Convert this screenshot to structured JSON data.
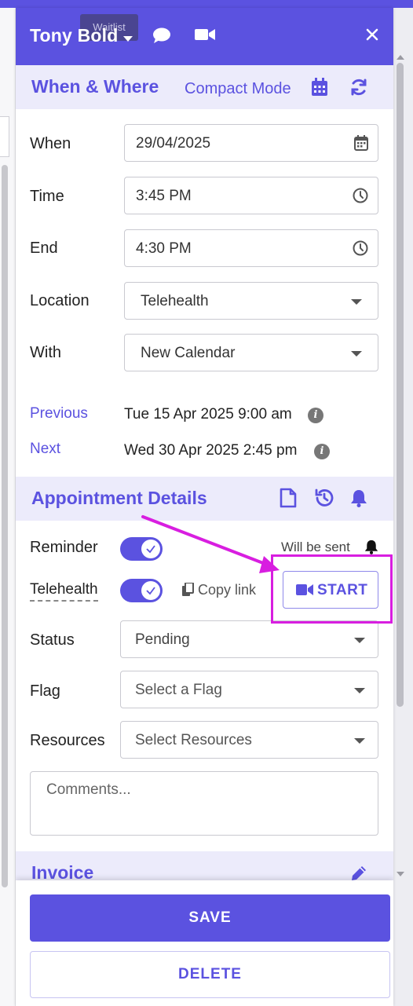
{
  "header": {
    "patient_name": "Tony Bold",
    "tooltip": "Waitlist"
  },
  "when_where": {
    "title": "When & Where",
    "compact_mode": "Compact Mode",
    "when_label": "When",
    "when_value": "29/04/2025",
    "time_label": "Time",
    "time_value": "3:45 PM",
    "end_label": "End",
    "end_value": "4:30 PM",
    "location_label": "Location",
    "location_value": "Telehealth",
    "with_label": "With",
    "with_value": "New Calendar",
    "previous_label": "Previous",
    "previous_value": "Tue 15 Apr 2025 9:00 am",
    "next_label": "Next",
    "next_value": "Wed 30 Apr 2025 2:45 pm"
  },
  "appointment": {
    "title": "Appointment Details",
    "reminder_label": "Reminder",
    "reminder_on": true,
    "will_be_sent": "Will be sent",
    "telehealth_label": "Telehealth",
    "telehealth_on": true,
    "copy_link": "Copy link",
    "start_label": "START",
    "status_label": "Status",
    "status_value": "Pending",
    "flag_label": "Flag",
    "flag_placeholder": "Select a Flag",
    "resources_label": "Resources",
    "resources_placeholder": "Select Resources",
    "comments_placeholder": "Comments..."
  },
  "invoice": {
    "title": "Invoice"
  },
  "footer": {
    "save": "SAVE",
    "delete": "DELETE"
  },
  "colors": {
    "brand": "#5b52e0",
    "section_bg": "#ecebfb",
    "annotation": "#d81ee0"
  },
  "icons": [
    "chevron-down-icon",
    "chat-icon",
    "video-icon",
    "close-icon",
    "calendar-icon",
    "refresh-icon",
    "clock-icon",
    "info-icon",
    "document-icon",
    "history-icon",
    "bell-icon",
    "check-icon",
    "copy-icon",
    "pencil-icon"
  ]
}
